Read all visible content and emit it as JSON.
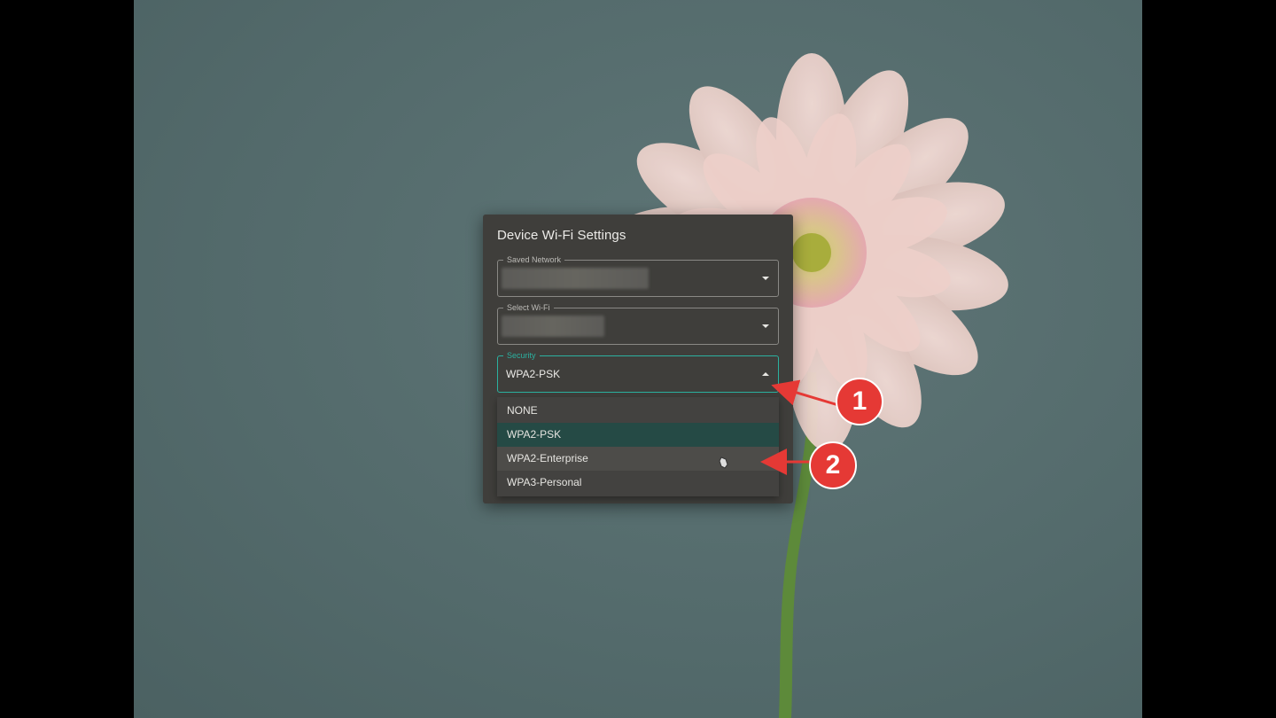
{
  "dialog": {
    "title": "Device Wi-Fi Settings",
    "saved_network": {
      "label": "Saved Network",
      "value": ""
    },
    "select_wifi": {
      "label": "Select Wi-Fi",
      "value": ""
    },
    "security": {
      "label": "Security",
      "value": "WPA2-PSK"
    },
    "security_options": [
      {
        "label": "NONE",
        "state": "normal"
      },
      {
        "label": "WPA2-PSK",
        "state": "selected"
      },
      {
        "label": "WPA2-Enterprise",
        "state": "hover"
      },
      {
        "label": "WPA3-Personal",
        "state": "normal"
      }
    ]
  },
  "annotations": [
    {
      "number": "1"
    },
    {
      "number": "2"
    }
  ],
  "colors": {
    "accent": "#2bb1a0",
    "annotation": "#e53935",
    "dialog_bg": "#3f3e3b"
  }
}
